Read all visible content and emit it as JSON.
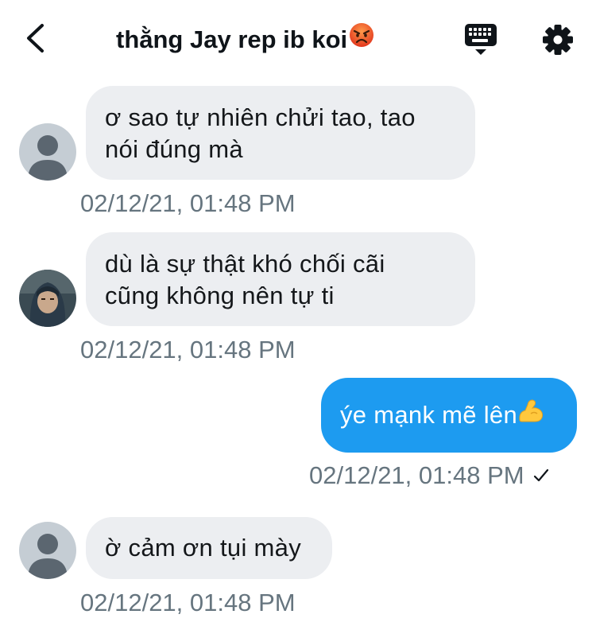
{
  "header": {
    "title": "thằng Jay rep ib koi",
    "back_icon": "chevron-left-icon",
    "keyboard_icon": "keyboard-icon",
    "settings_icon": "gear-icon",
    "title_emoji": "angry-face-emoji"
  },
  "colors": {
    "incoming_bubble": "#eceef1",
    "outgoing_bubble": "#1d9bf0",
    "timestamp": "#66757f"
  },
  "messages": [
    {
      "direction": "incoming",
      "avatar": "default-avatar",
      "lines": [
        "ơ sao tự nhiên chửi tao, tao",
        "nói đúng mà"
      ],
      "timestamp": "02/12/21, 01:48 PM"
    },
    {
      "direction": "incoming",
      "avatar": "photo-avatar",
      "lines": [
        "dù là sự thật khó chối cãi",
        "cũng không nên tự ti"
      ],
      "timestamp": "02/12/21, 01:48 PM"
    },
    {
      "direction": "outgoing",
      "text": "ýe mạnk mẽ lên",
      "emoji": "flexed-biceps-emoji",
      "timestamp": "02/12/21, 01:48 PM",
      "status_icon": "checkmark-icon"
    },
    {
      "direction": "incoming",
      "avatar": "default-avatar",
      "lines": [
        "ờ cảm ơn tụi mày"
      ],
      "timestamp": "02/12/21, 01:48 PM"
    }
  ]
}
